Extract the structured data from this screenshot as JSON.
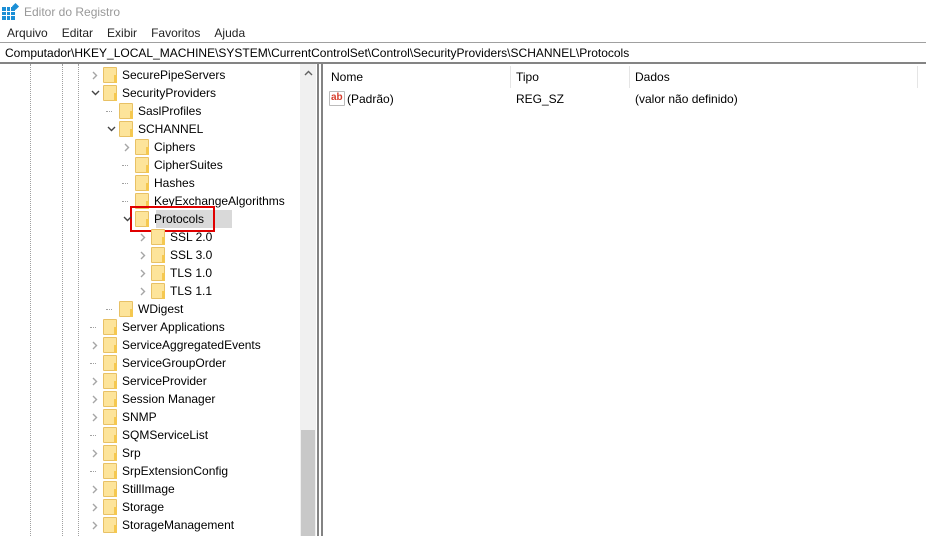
{
  "window": {
    "title": "Editor do Registro"
  },
  "menu": [
    "Arquivo",
    "Editar",
    "Exibir",
    "Favoritos",
    "Ajuda"
  ],
  "address": "Computador\\HKEY_LOCAL_MACHINE\\SYSTEM\\CurrentControlSet\\Control\\SecurityProviders\\SCHANNEL\\Protocols",
  "tree": {
    "nodes": [
      {
        "label": "SecurePipeServers",
        "level": 0,
        "expander": "collapsed"
      },
      {
        "label": "SecurityProviders",
        "level": 0,
        "expander": "expanded"
      },
      {
        "label": "SaslProfiles",
        "level": 1,
        "expander": "none"
      },
      {
        "label": "SCHANNEL",
        "level": 1,
        "expander": "expanded"
      },
      {
        "label": "Ciphers",
        "level": 2,
        "expander": "collapsed"
      },
      {
        "label": "CipherSuites",
        "level": 2,
        "expander": "none"
      },
      {
        "label": "Hashes",
        "level": 2,
        "expander": "none"
      },
      {
        "label": "KeyExchangeAlgorithms",
        "level": 2,
        "expander": "none"
      },
      {
        "label": "Protocols",
        "level": 2,
        "expander": "expanded",
        "selected": true
      },
      {
        "label": "SSL 2.0",
        "level": 3,
        "expander": "collapsed"
      },
      {
        "label": "SSL 3.0",
        "level": 3,
        "expander": "collapsed"
      },
      {
        "label": "TLS 1.0",
        "level": 3,
        "expander": "collapsed"
      },
      {
        "label": "TLS 1.1",
        "level": 3,
        "expander": "collapsed"
      },
      {
        "label": "WDigest",
        "level": 1,
        "expander": "none"
      },
      {
        "label": "Server Applications",
        "level": 0,
        "expander": "none"
      },
      {
        "label": "ServiceAggregatedEvents",
        "level": 0,
        "expander": "collapsed"
      },
      {
        "label": "ServiceGroupOrder",
        "level": 0,
        "expander": "none"
      },
      {
        "label": "ServiceProvider",
        "level": 0,
        "expander": "collapsed"
      },
      {
        "label": "Session Manager",
        "level": 0,
        "expander": "collapsed"
      },
      {
        "label": "SNMP",
        "level": 0,
        "expander": "collapsed"
      },
      {
        "label": "SQMServiceList",
        "level": 0,
        "expander": "none"
      },
      {
        "label": "Srp",
        "level": 0,
        "expander": "collapsed"
      },
      {
        "label": "SrpExtensionConfig",
        "level": 0,
        "expander": "none"
      },
      {
        "label": "StillImage",
        "level": 0,
        "expander": "collapsed"
      },
      {
        "label": "Storage",
        "level": 0,
        "expander": "collapsed"
      },
      {
        "label": "StorageManagement",
        "level": 0,
        "expander": "collapsed"
      }
    ],
    "highlight_color": "#e00000"
  },
  "list": {
    "columns": [
      "Nome",
      "Tipo",
      "Dados"
    ],
    "rows": [
      {
        "icon": "string-value-icon",
        "icon_text": "ab",
        "name": "(Padrão)",
        "type": "REG_SZ",
        "data": "(valor não definido)"
      }
    ]
  },
  "icons": {
    "scroll_up": "▲",
    "expanded": "⌄",
    "collapsed": "›"
  }
}
